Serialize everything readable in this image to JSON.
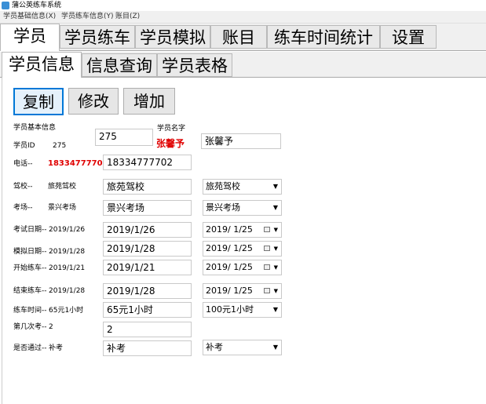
{
  "window": {
    "title": "蒲公英练车系统"
  },
  "menu": [
    "学员基础信息(X)",
    "学员练车信息(Y)",
    "账目(Z)"
  ],
  "main_tabs": [
    "学员",
    "学员练车",
    "学员模拟",
    "账目",
    "练车时间统计",
    "设置"
  ],
  "sub_tabs": [
    "学员信息",
    "信息查询",
    "学员表格"
  ],
  "toolbar": {
    "copy": "复制",
    "edit": "修改",
    "add": "增加"
  },
  "form": {
    "section_title": "学员基本信息",
    "id_label": "学员ID",
    "id_value": "275",
    "id_input": "275",
    "name_label": "学员名字",
    "name_value": "张馨予",
    "name_input": "张馨予",
    "phone_label": "电话--",
    "phone_value": "18334777702",
    "phone_input": "18334777702",
    "school_label": "驾校--",
    "school_value": "旅苑驾校",
    "school_input": "旅苑驾校",
    "school_select": "旅苑驾校",
    "site_label": "考场--",
    "site_value": "景兴考场",
    "site_input": "景兴考场",
    "site_select": "景兴考场",
    "exam_label": "考试日期--",
    "exam_value": "2019/1/26",
    "exam_input": "2019/1/26",
    "exam_picker": "2019/  1/25",
    "sim_label": "模拟日期--",
    "sim_value": "2019/1/28",
    "sim_input": "2019/1/28",
    "sim_picker": "2019/  1/25",
    "start_label": "开始练车--",
    "start_value": "2019/1/21",
    "start_input": "2019/1/21",
    "start_picker": "2019/  1/25",
    "end_label": "结束练车--",
    "end_value": "2019/1/28",
    "end_input": "2019/1/28",
    "end_picker": "2019/  1/25",
    "time_label": "练车时间--",
    "time_value": "65元1小时",
    "time_input": "65元1小时",
    "time_select": "100元1小时",
    "attempt_label": "第几次考--",
    "attempt_value": "2",
    "attempt_input": "2",
    "pass_label": "是否通过--",
    "pass_value": "补考",
    "pass_input": "补考",
    "pass_select": "补考"
  },
  "icons": {
    "dropdown": "chevron-down-icon",
    "calendar": "calendar-icon"
  },
  "colors": {
    "highlight": "#e00000",
    "focus": "#0078d7"
  }
}
